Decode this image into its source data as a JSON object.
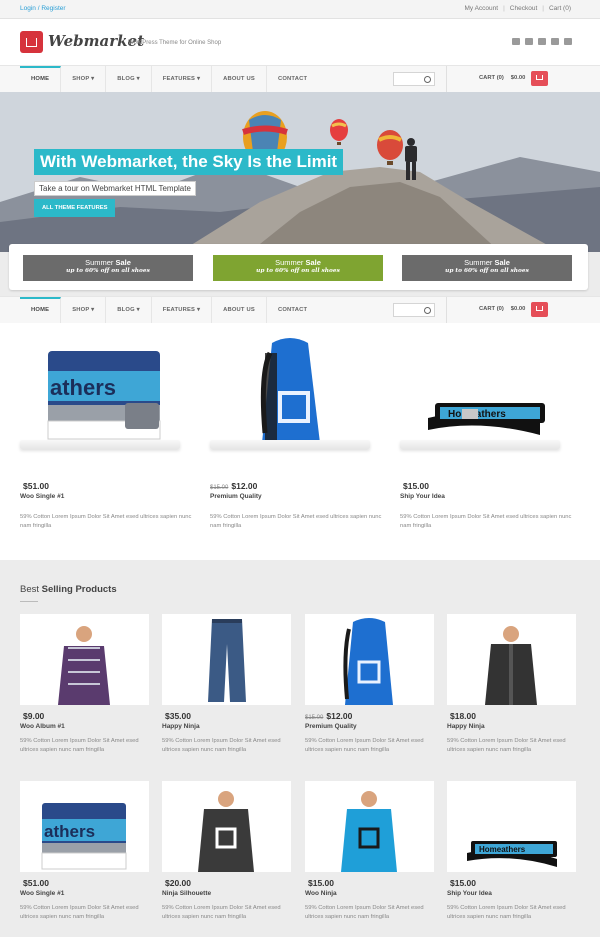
{
  "topbar": {
    "login": "Login / Register",
    "account": "My Account",
    "checkout": "Checkout",
    "cart": "Cart (0)"
  },
  "header": {
    "logo": "Webmarket",
    "tagline": "WordPress Theme for Online Shop"
  },
  "nav": {
    "items": [
      "HOME",
      "SHOP ▾",
      "BLOG ▾",
      "FEATURES ▾",
      "ABOUT US",
      "CONTACT"
    ],
    "cart_label": "CART (0)",
    "cart_amount": "$0.00"
  },
  "hero": {
    "title": "With Webmarket, the Sky Is the Limit",
    "subtitle": "Take a tour on Webmarket HTML Template",
    "button": "ALL THEME FEATURES"
  },
  "sales": [
    {
      "word": "Summer",
      "bold": "Sale",
      "sub": "up to 60% off on all shoes",
      "color": "#6b6b6b"
    },
    {
      "word": "Summer",
      "bold": "Sale",
      "sub": "up to 60% off on all shoes",
      "color": "#7fa431"
    },
    {
      "word": "Summer",
      "bold": "Sale",
      "sub": "up to 60% off on all shoes",
      "color": "#6b6b6b"
    }
  ],
  "featured": [
    {
      "price": "$51.00",
      "old_price": "",
      "name": "Woo Single #1",
      "desc": "59% Cotton Lorem Ipsum Dolor Sit Amet esed ultrices sapien nunc nam fringilla"
    },
    {
      "price": "$12.00",
      "old_price": "$15.00",
      "name": "Premium Quality",
      "desc": "59% Cotton Lorem Ipsum Dolor Sit Amet esed ultrices sapien nunc nam fringilla"
    },
    {
      "price": "$15.00",
      "old_price": "",
      "name": "Ship Your Idea",
      "desc": "59% Cotton Lorem Ipsum Dolor Sit Amet esed ultrices sapien nunc nam fringilla"
    }
  ],
  "best": {
    "title_light": "Best",
    "title_bold": "Selling Products",
    "items": [
      {
        "price": "$9.00",
        "old_price": "",
        "name": "Woo Album #1",
        "desc": "59% Cotton Lorem Ipsum Dolor Sit Amet esed ultrices sapien nunc nam fringilla"
      },
      {
        "price": "$35.00",
        "old_price": "",
        "name": "Happy Ninja",
        "desc": "59% Cotton Lorem Ipsum Dolor Sit Amet esed ultrices sapien nunc nam fringilla"
      },
      {
        "price": "$12.00",
        "old_price": "$15.00",
        "name": "Premium Quality",
        "desc": "59% Cotton Lorem Ipsum Dolor Sit Amet esed ultrices sapien nunc nam fringilla"
      },
      {
        "price": "$18.00",
        "old_price": "",
        "name": "Happy Ninja",
        "desc": "59% Cotton Lorem Ipsum Dolor Sit Amet esed ultrices sapien nunc nam fringilla"
      },
      {
        "price": "$51.00",
        "old_price": "",
        "name": "Woo Single #1",
        "desc": "59% Cotton Lorem Ipsum Dolor Sit Amet esed ultrices sapien nunc nam fringilla"
      },
      {
        "price": "$20.00",
        "old_price": "",
        "name": "Ninja Silhouette",
        "desc": "59% Cotton Lorem Ipsum Dolor Sit Amet esed ultrices sapien nunc nam fringilla"
      },
      {
        "price": "$15.00",
        "old_price": "",
        "name": "Woo Ninja",
        "desc": "59% Cotton Lorem Ipsum Dolor Sit Amet esed ultrices sapien nunc nam fringilla"
      },
      {
        "price": "$15.00",
        "old_price": "",
        "name": "Ship Your Idea",
        "desc": "59% Cotton Lorem Ipsum Dolor Sit Amet esed ultrices sapien nunc nam fringilla"
      }
    ]
  },
  "colors": {
    "accent": "#2cb9c9",
    "cart_button": "#e54e58",
    "logo": "#d6333c",
    "sale_green": "#7fa431",
    "sale_gray": "#6b6b6b"
  }
}
